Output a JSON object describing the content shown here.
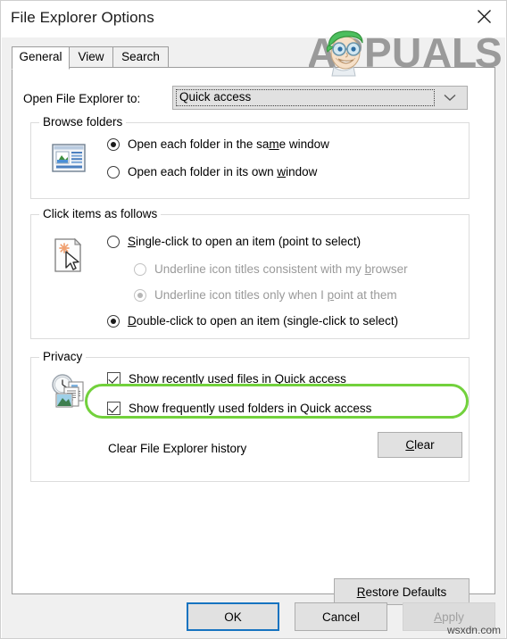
{
  "window": {
    "title": "File Explorer Options",
    "close_icon": "close-icon"
  },
  "tabs": [
    {
      "label": "General",
      "active": true
    },
    {
      "label": "View",
      "active": false
    },
    {
      "label": "Search",
      "active": false
    }
  ],
  "general": {
    "open_to": {
      "label": "Open File Explorer to:",
      "value": "Quick access",
      "arrow_icon": "chevron-down-icon"
    },
    "browse_folders": {
      "title": "Browse folders",
      "icon": "folder-window-icon",
      "options": [
        {
          "text_before": "Open each folder in the sa",
          "accel": "m",
          "text_after": "e window",
          "checked": true,
          "disabled": false
        },
        {
          "text_before": "Open each folder in its own ",
          "accel": "w",
          "text_after": "indow",
          "checked": false,
          "disabled": false
        }
      ]
    },
    "click_items": {
      "title": "Click items as follows",
      "icon": "pointer-document-icon",
      "options": [
        {
          "text_before": "",
          "accel": "S",
          "text_after": "ingle-click to open an item (point to select)",
          "checked": false,
          "disabled": false,
          "indent": 0
        },
        {
          "text_before": "Underline icon titles consistent with my ",
          "accel": "b",
          "text_after": "rowser",
          "checked": false,
          "disabled": true,
          "indent": 1
        },
        {
          "text_before": "Underline icon titles only when I ",
          "accel": "p",
          "text_after": "oint at them",
          "checked": true,
          "disabled": true,
          "indent": 1
        },
        {
          "text_before": "",
          "accel": "D",
          "text_after": "ouble-click to open an item (single-click to select)",
          "checked": true,
          "disabled": false,
          "indent": 0
        }
      ]
    },
    "privacy": {
      "title": "Privacy",
      "icon": "clock-files-icon",
      "checkboxes": [
        {
          "label": "Show recently used files in Quick access",
          "checked": true
        },
        {
          "label": "Show frequently used folders in Quick access",
          "checked": true
        }
      ],
      "clear_history_label": "Clear File Explorer history",
      "clear_button": "Clear",
      "clear_button_accel": "C"
    },
    "restore_defaults": "Restore Defaults",
    "restore_defaults_accel": "R"
  },
  "footer": {
    "ok": "OK",
    "cancel": "Cancel",
    "apply": "Apply",
    "apply_accel": "A",
    "apply_disabled": true
  },
  "annotations": {
    "highlight_color": "#72d13c",
    "highlight_target": "Double-click to open an item (single-click to select)"
  },
  "watermarks": {
    "logo_text": "APPUALS",
    "site": "wsxdn.com"
  }
}
